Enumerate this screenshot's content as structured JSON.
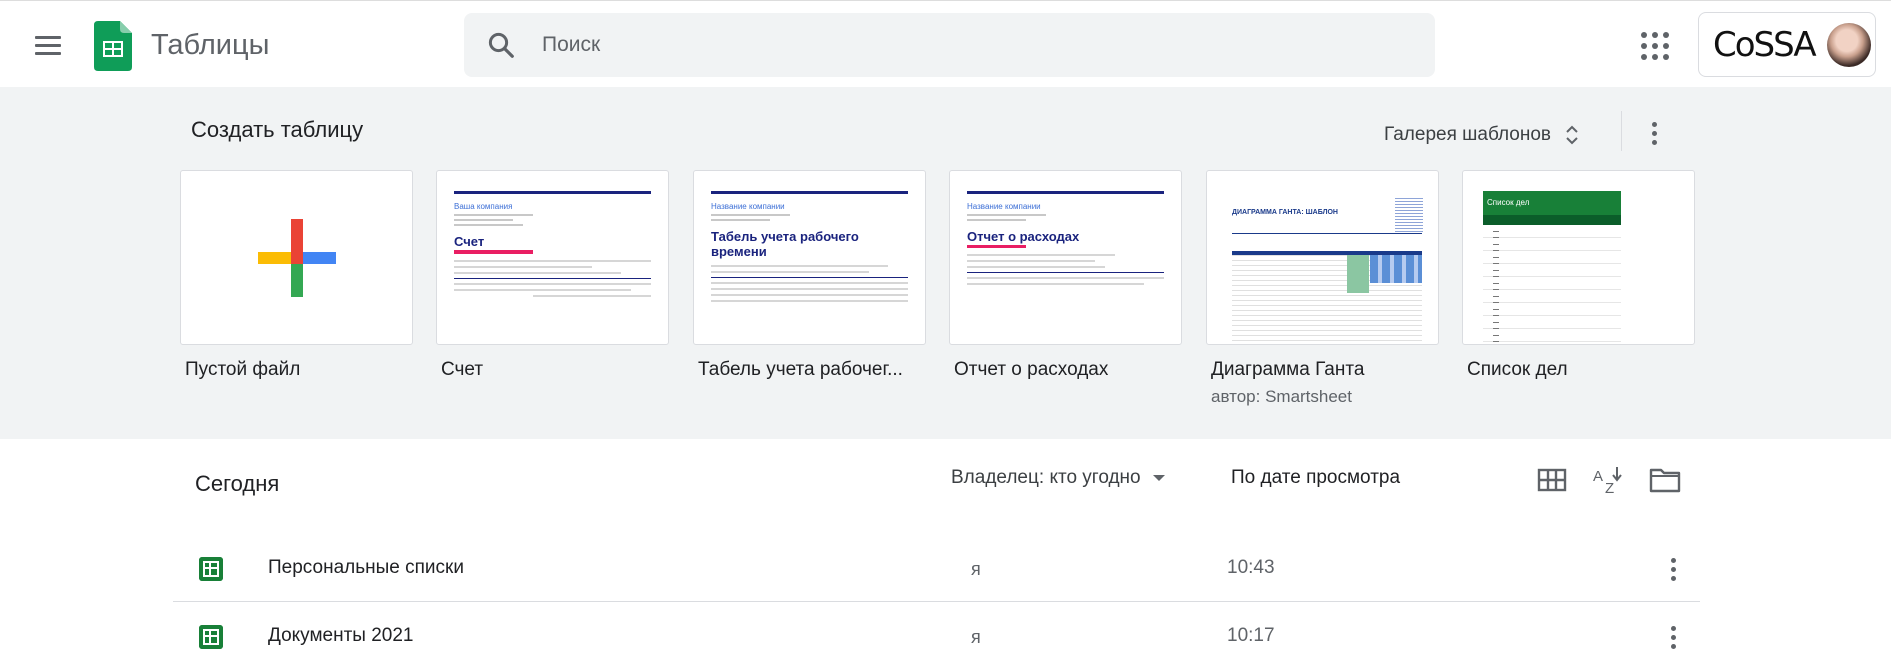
{
  "header": {
    "app_title": "Таблицы",
    "search_placeholder": "Поиск",
    "account_brand": "CoSSA"
  },
  "templates": {
    "title": "Создать таблицу",
    "gallery_label": "Галерея шаблонов",
    "items": [
      {
        "label": "Пустой файл",
        "sub": ""
      },
      {
        "label": "Счет",
        "sub": "",
        "preview_company": "Ваша компания",
        "preview_title": "Счет"
      },
      {
        "label": "Табель учета рабочег...",
        "sub": "",
        "preview_company": "Название компании",
        "preview_title": "Табель учета рабочего времени"
      },
      {
        "label": "Отчет о расходах",
        "sub": "",
        "preview_company": "Название компании",
        "preview_title": "Отчет о расходах"
      },
      {
        "label": "Диаграмма Ганта",
        "sub": "автор: Smartsheet",
        "preview_title": "ДИАГРАММА ГАНТА: ШАБЛОН"
      },
      {
        "label": "Список дел",
        "sub": "",
        "preview_title": "Список дел"
      }
    ]
  },
  "files": {
    "section_title": "Сегодня",
    "owner_filter": "Владелец: кто угодно",
    "sort_label": "По дате просмотра",
    "rows": [
      {
        "name": "Персональные списки",
        "owner": "я",
        "time": "10:43"
      },
      {
        "name": "Документы 2021",
        "owner": "я",
        "time": "10:17"
      }
    ]
  },
  "colors": {
    "sheets_green": "#188038",
    "band_bg": "#f1f3f4",
    "plus_red": "#ea4335",
    "plus_blue": "#4285f4",
    "plus_yellow": "#fbbc04",
    "plus_green": "#34a853"
  },
  "icons": [
    "menu-icon",
    "sheets-logo-icon",
    "search-icon",
    "apps-grid-icon",
    "unfold-icon",
    "more-vert-icon",
    "grid-view-icon",
    "sort-az-icon",
    "folder-icon",
    "sheets-file-icon"
  ]
}
